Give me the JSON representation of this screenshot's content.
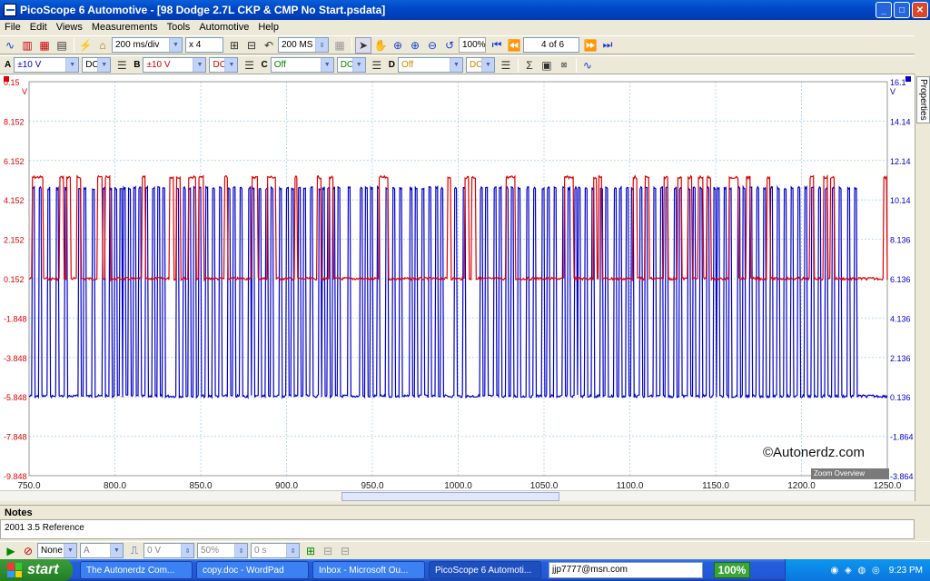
{
  "window": {
    "title": "PicoScope 6 Automotive - [98 Dodge 2.7L CKP & CMP No Start.psdata]"
  },
  "menu": [
    "File",
    "Edit",
    "Views",
    "Measurements",
    "Tools",
    "Automotive",
    "Help"
  ],
  "toolbar": {
    "timebase": "200 ms/div",
    "zoom": "x 4",
    "samples": "200 MS",
    "zoom_pct": "100%",
    "buffer": "4 of 6"
  },
  "channels": [
    {
      "label": "A",
      "range": "±10 V",
      "coupling": "DC"
    },
    {
      "label": "B",
      "range": "±10 V",
      "coupling": "DC"
    },
    {
      "label": "C",
      "range": "Off",
      "coupling": "DC"
    },
    {
      "label": "D",
      "range": "Off",
      "coupling": "DC"
    }
  ],
  "colors": {
    "channel_a": "#e00000",
    "channel_b": "#0000c8",
    "grid": "#b8d8ec"
  },
  "chart_data": {
    "type": "line",
    "x_ticks": [
      "750.0",
      "800.0",
      "850.0",
      "900.0",
      "950.0",
      "1000.0",
      "1050.0",
      "1100.0",
      "1150.0",
      "1200.0",
      "1250.0"
    ],
    "xlim": [
      750,
      1250
    ],
    "left_axis": {
      "unit": "V",
      "ticks": [
        "0.15",
        "8.152",
        "6.152",
        "4.152",
        "2.152",
        "0.152",
        "-1.848",
        "-3.848",
        "-5.848",
        "-7.848",
        "-9.848"
      ]
    },
    "right_axis": {
      "unit": "V",
      "ticks": [
        "16.1",
        "14.14",
        "12.14",
        "10.14",
        "8.136",
        "6.136",
        "4.136",
        "2.136",
        "0.136",
        "-1.864",
        "-3.864"
      ]
    },
    "series": [
      {
        "low": 0.15,
        "high": 5.3,
        "pulses": [
          [
            752,
            755
          ],
          [
            755.5,
            758
          ],
          [
            768,
            770
          ],
          [
            772,
            774
          ],
          [
            778,
            780
          ],
          [
            790,
            792.5
          ],
          [
            794.5,
            797
          ],
          [
            816,
            817.5
          ],
          [
            832,
            834
          ],
          [
            836,
            838
          ],
          [
            843,
            845
          ],
          [
            845.5,
            847
          ],
          [
            849,
            851.5
          ],
          [
            864,
            865.5
          ],
          [
            880,
            883
          ],
          [
            889,
            891
          ],
          [
            891.5,
            893.5
          ],
          [
            905,
            906
          ],
          [
            918,
            920
          ],
          [
            925,
            927
          ],
          [
            954,
            956.5
          ],
          [
            957,
            959
          ],
          [
            994,
            995.5
          ],
          [
            1004,
            1006
          ],
          [
            1008,
            1010
          ],
          [
            1028,
            1030.5
          ],
          [
            1031,
            1033
          ],
          [
            1062,
            1064.5
          ],
          [
            1065,
            1067
          ],
          [
            1079,
            1080.5
          ],
          [
            1082,
            1083.5
          ],
          [
            1102,
            1104
          ],
          [
            1109,
            1111
          ],
          [
            1120,
            1122
          ],
          [
            1128,
            1130
          ],
          [
            1134,
            1136
          ],
          [
            1140,
            1142.5
          ],
          [
            1145,
            1147
          ],
          [
            1158,
            1160.5
          ],
          [
            1161,
            1163
          ],
          [
            1168,
            1170
          ],
          [
            1180,
            1181.5
          ],
          [
            1205,
            1207
          ],
          [
            1213,
            1215
          ],
          [
            1217,
            1219
          ],
          [
            1248,
            1249.5
          ]
        ]
      },
      {
        "low": 0.136,
        "high": 10.7,
        "pulses": [
          [
            752,
            753
          ],
          [
            756,
            757
          ],
          [
            761,
            762
          ],
          [
            766,
            767
          ],
          [
            771,
            772
          ],
          [
            779,
            780
          ],
          [
            782,
            783
          ],
          [
            787,
            788
          ],
          [
            793,
            794
          ],
          [
            797,
            798
          ],
          [
            800,
            801
          ],
          [
            803,
            804
          ],
          [
            805,
            806
          ],
          [
            808,
            809
          ],
          [
            811,
            812
          ],
          [
            814,
            815
          ],
          [
            818,
            819
          ],
          [
            822,
            823
          ],
          [
            825,
            826
          ],
          [
            828,
            829
          ],
          [
            836,
            837
          ],
          [
            840,
            841
          ],
          [
            843,
            844
          ],
          [
            846,
            847
          ],
          [
            849,
            850
          ],
          [
            853,
            854
          ],
          [
            857,
            858
          ],
          [
            861,
            862
          ],
          [
            866,
            867
          ],
          [
            869,
            870
          ],
          [
            873,
            874
          ],
          [
            878,
            879
          ],
          [
            880,
            881
          ],
          [
            884,
            885
          ],
          [
            888,
            889
          ],
          [
            891,
            892
          ],
          [
            896,
            897
          ],
          [
            900,
            901
          ],
          [
            903,
            904
          ],
          [
            907,
            908
          ],
          [
            910,
            911
          ],
          [
            914,
            915
          ],
          [
            919,
            920
          ],
          [
            921,
            922
          ],
          [
            924,
            925
          ],
          [
            927,
            928
          ],
          [
            930,
            931
          ],
          [
            936,
            937
          ],
          [
            943,
            944
          ],
          [
            946,
            947
          ],
          [
            949,
            950
          ],
          [
            953,
            954
          ],
          [
            958,
            959
          ],
          [
            962,
            963
          ],
          [
            966,
            967
          ],
          [
            972,
            973
          ],
          [
            975,
            976
          ],
          [
            979,
            980
          ],
          [
            983,
            984
          ],
          [
            987,
            988
          ],
          [
            990,
            991
          ],
          [
            998,
            999
          ],
          [
            1003,
            1004
          ],
          [
            1013,
            1014
          ],
          [
            1016,
            1017
          ],
          [
            1021,
            1022
          ],
          [
            1024,
            1025
          ],
          [
            1028,
            1029
          ],
          [
            1031,
            1032
          ],
          [
            1035,
            1036
          ],
          [
            1040,
            1041
          ],
          [
            1044,
            1045
          ],
          [
            1049,
            1050
          ],
          [
            1052,
            1053
          ],
          [
            1056,
            1057
          ],
          [
            1061,
            1062
          ],
          [
            1064,
            1065
          ],
          [
            1068,
            1069
          ],
          [
            1070,
            1071
          ],
          [
            1074,
            1075
          ],
          [
            1078,
            1079
          ],
          [
            1083,
            1084
          ],
          [
            1086,
            1087
          ],
          [
            1091,
            1092
          ],
          [
            1094,
            1095
          ],
          [
            1098,
            1099
          ],
          [
            1101,
            1102
          ],
          [
            1106,
            1107
          ],
          [
            1109,
            1110
          ],
          [
            1114,
            1115
          ],
          [
            1118,
            1119
          ],
          [
            1121,
            1122
          ],
          [
            1126,
            1127
          ],
          [
            1129,
            1130
          ],
          [
            1134,
            1135
          ],
          [
            1137,
            1138
          ],
          [
            1141,
            1142
          ],
          [
            1145,
            1146
          ],
          [
            1149,
            1150
          ],
          [
            1151,
            1152
          ],
          [
            1155,
            1156
          ],
          [
            1158,
            1159
          ],
          [
            1163,
            1164
          ],
          [
            1166,
            1167
          ],
          [
            1170,
            1171
          ],
          [
            1174,
            1175
          ],
          [
            1178,
            1179
          ],
          [
            1182,
            1183
          ],
          [
            1186,
            1187
          ],
          [
            1190,
            1191
          ],
          [
            1194,
            1195
          ],
          [
            1198,
            1199
          ],
          [
            1202,
            1203
          ],
          [
            1206,
            1207
          ],
          [
            1210,
            1211
          ],
          [
            1214,
            1215
          ],
          [
            1218,
            1219
          ],
          [
            1222,
            1223
          ],
          [
            1227,
            1228
          ],
          [
            1231,
            1232
          ]
        ]
      }
    ]
  },
  "watermark": "©Autonerdz.com",
  "zoom_overview": "Zoom Overview",
  "properties_tab": "Properties",
  "notes": {
    "header": "Notes",
    "text": "2001 3.5 Reference"
  },
  "bottom": {
    "trigger": "None",
    "channel": "A",
    "level": "0 V",
    "pct": "50%",
    "delay": "0 s"
  },
  "taskbar": {
    "start": "start",
    "tasks": [
      "The Autonerdz Com...",
      "copy.doc - WordPad",
      "Inbox - Microsoft Ou...",
      "PicoScope 6 Automoti..."
    ],
    "address": "jjp7777@msn.com",
    "zoom": "100%",
    "time": "9:23 PM"
  }
}
